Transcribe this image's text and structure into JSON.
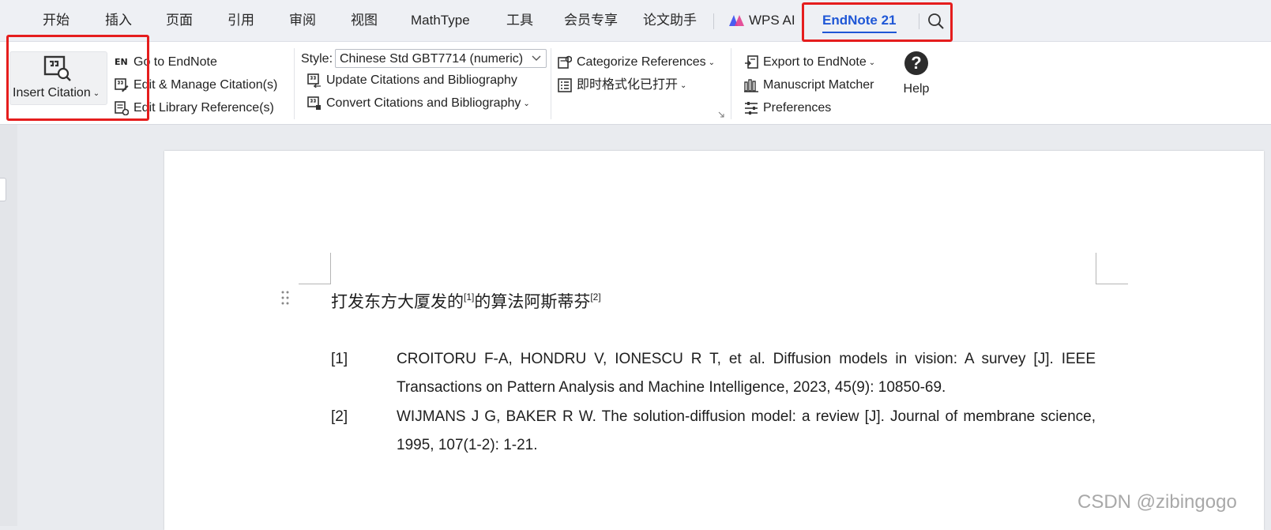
{
  "menu": {
    "tabs": [
      "开始",
      "插入",
      "页面",
      "引用",
      "审阅",
      "视图",
      "MathType",
      "工具",
      "会员专享",
      "论文助手"
    ],
    "wps_ai": "WPS AI",
    "endnote": "EndNote 21"
  },
  "ribbon": {
    "insert_citation": "Insert Citation",
    "go_to_endnote": "Go to EndNote",
    "edit_manage": "Edit & Manage Citation(s)",
    "edit_library": "Edit Library Reference(s)",
    "style_label": "Style:",
    "style_value": "Chinese Std GBT7714 (numeric)",
    "update_citations": "Update Citations and Bibliography",
    "convert_citations": "Convert Citations and Bibliography",
    "categorize": "Categorize References",
    "instant_format": "即时格式化已打开",
    "export": "Export to EndNote",
    "manuscript": "Manuscript Matcher",
    "preferences": "Preferences",
    "help": "Help",
    "en_badge": "EN"
  },
  "document": {
    "line_parts": [
      "打发东方大厦发的",
      "[1]",
      "的算法阿斯蒂芬",
      "[2]"
    ],
    "references": [
      {
        "num": "[1]",
        "text": "CROITORU F-A, HONDRU V, IONESCU R T, et al. Diffusion models in vision: A survey [J]. IEEE Transactions on Pattern Analysis and Machine Intelligence, 2023, 45(9): 10850-69."
      },
      {
        "num": "[2]",
        "text": "WIJMANS J G, BAKER R W. The solution-diffusion model: a review [J]. Journal of membrane science, 1995, 107(1-2): 1-21."
      }
    ]
  },
  "watermark": "CSDN @zibingogo",
  "colors": {
    "accent": "#1f57d6",
    "highlight": "#e51d1d"
  }
}
